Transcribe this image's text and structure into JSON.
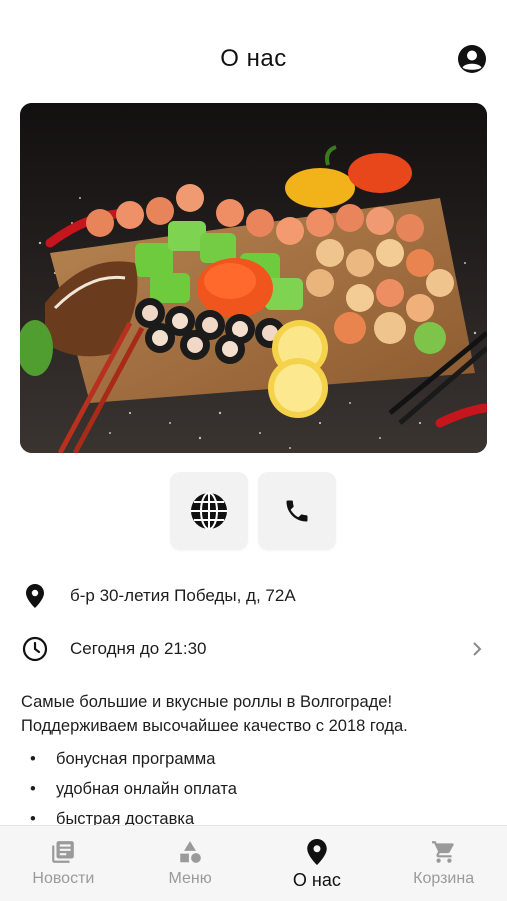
{
  "header": {
    "title": "О нас",
    "profile_icon": "account-circle-icon"
  },
  "hero": {
    "image": "sushi-platter-photo"
  },
  "actions": [
    {
      "icon": "globe-icon"
    },
    {
      "icon": "phone-icon"
    }
  ],
  "info": {
    "address": "б-р 30-летия Победы, д, 72А",
    "hours": "Сегодня до 21:30"
  },
  "about": {
    "description": "Самые большие и вкусные роллы в Волгограде! Поддерживаем высочайшее качество с 2018 года.",
    "features": [
      "бонусная программа",
      "удобная онлайн оплата",
      "быстрая доставка"
    ],
    "bullet": "•"
  },
  "tabs": [
    {
      "label": "Новости",
      "icon": "news-icon"
    },
    {
      "label": "Меню",
      "icon": "shapes-icon"
    },
    {
      "label": "О нас",
      "icon": "location-pin-icon",
      "active": true
    },
    {
      "label": "Корзина",
      "icon": "cart-icon"
    }
  ],
  "colors": {
    "text": "#1b1b1b",
    "inactive_tab": "#9a9a9a",
    "button_bg": "#f2f2f2",
    "tabbar_bg": "#f6f6f6"
  }
}
